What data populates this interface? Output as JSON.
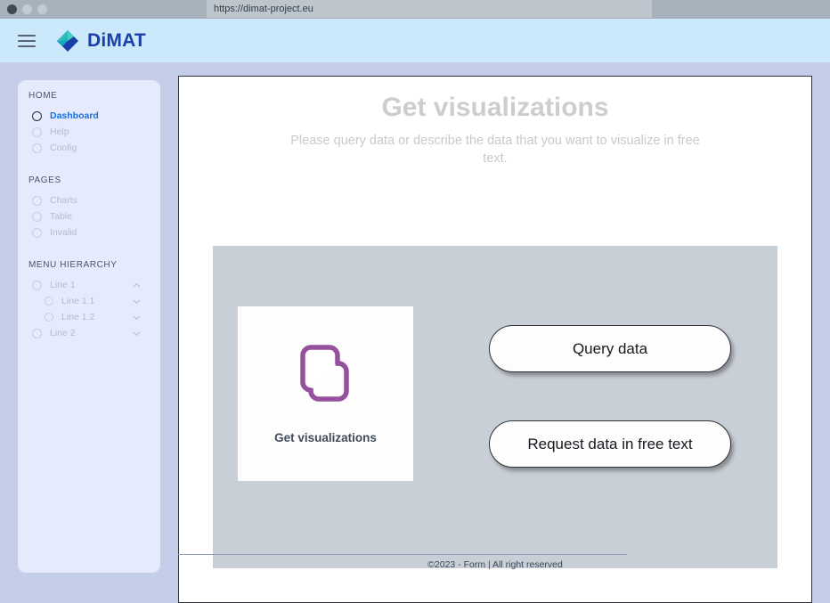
{
  "browser": {
    "url": "https://dimat-project.eu",
    "traffic_lights": [
      "close-dot",
      "minimize-dot",
      "maximize-dot"
    ]
  },
  "header": {
    "menu_icon": "hamburger-icon",
    "brand_icon": "dimat-diamond-logo",
    "brand_name": "DiMAT",
    "background_color": "#cbe9fb"
  },
  "sidebar": {
    "background_color": "#e6eafd",
    "groups": [
      {
        "title": "HOME",
        "items": [
          {
            "label": "Dashboard",
            "active": true,
            "chevron": null
          },
          {
            "label": "Help",
            "active": false,
            "chevron": null
          },
          {
            "label": "Config",
            "active": false,
            "chevron": null
          }
        ]
      },
      {
        "title": "PAGES",
        "items": [
          {
            "label": "Charts",
            "active": false,
            "chevron": null
          },
          {
            "label": "Table",
            "active": false,
            "chevron": null
          },
          {
            "label": "Invalid",
            "active": false,
            "chevron": null
          }
        ]
      },
      {
        "title": "MENU HIERARCHY",
        "items": [
          {
            "label": "Line 1",
            "active": false,
            "chevron": "up",
            "nested": false
          },
          {
            "label": "Line 1.1",
            "active": false,
            "chevron": "down",
            "nested": true
          },
          {
            "label": "Line 1.2",
            "active": false,
            "chevron": "down",
            "nested": true
          },
          {
            "label": "Line 2",
            "active": false,
            "chevron": "down",
            "nested": false
          }
        ]
      }
    ]
  },
  "main": {
    "title": "Get visualizations",
    "subtitle": "Please query data or describe the data that you want to visualize in free text.",
    "panel_color": "#c9cfd6",
    "tile": {
      "icon": "copy-duplicate-icon",
      "icon_color": "#96519e",
      "label": "Get visualizations"
    },
    "buttons": [
      {
        "label": "Query data",
        "name": "query-data-button"
      },
      {
        "label": "Request data in free text",
        "name": "request-free-text-button"
      }
    ]
  },
  "footer": {
    "text": "©2023 - Form |  All right reserved"
  }
}
